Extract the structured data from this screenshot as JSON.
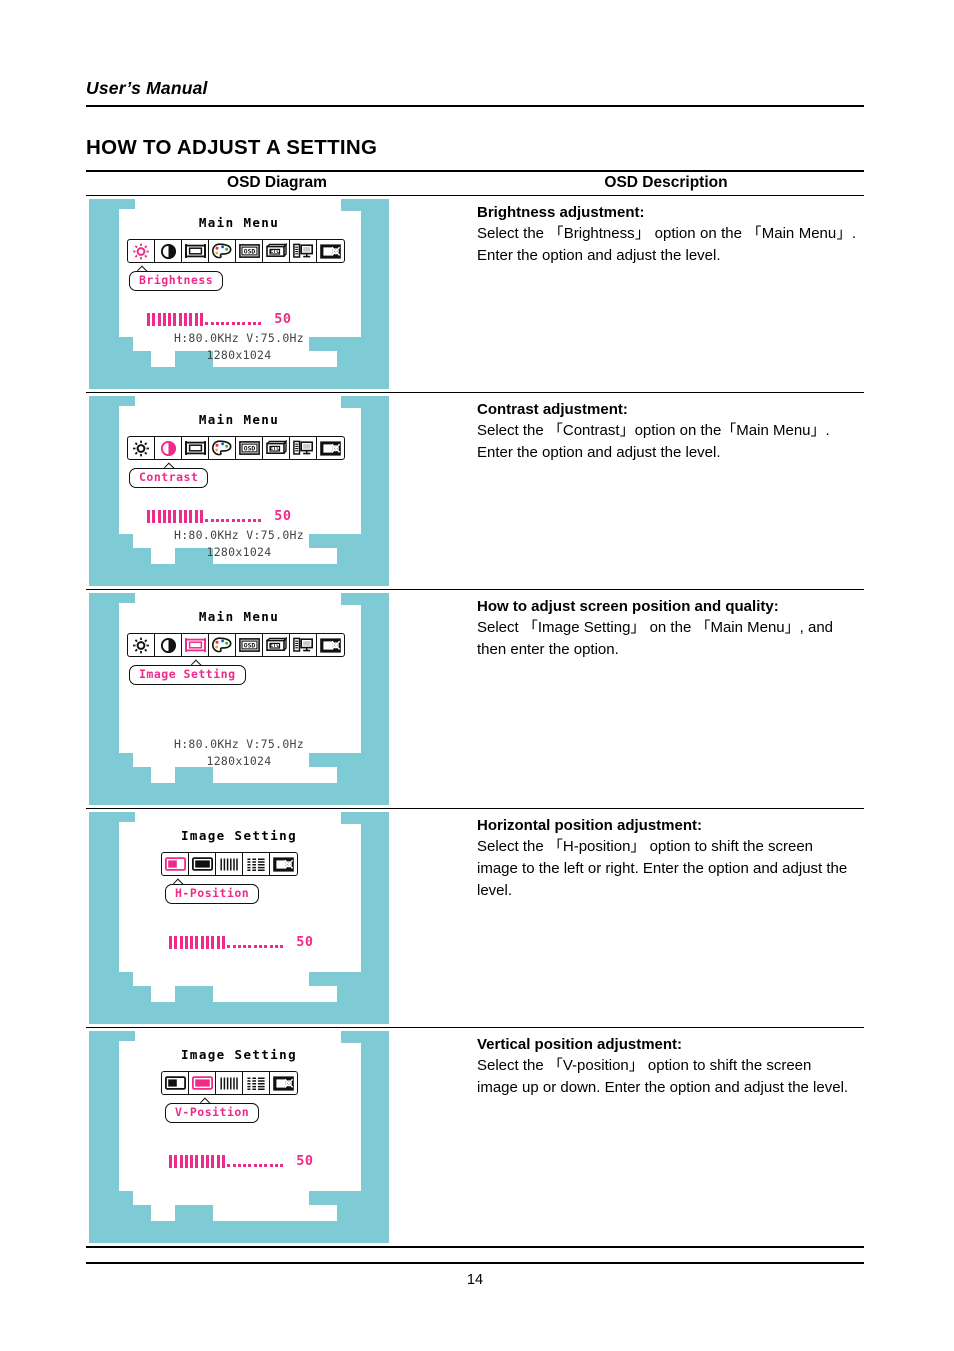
{
  "colors": {
    "teal": "#7ecbd5",
    "pink": "#ee2a8b",
    "rule": "#000000"
  },
  "header": {
    "manual_title": "User’s Manual",
    "section_title": "HOW TO ADJUST A SETTING"
  },
  "table": {
    "columns": {
      "diagram": "OSD Diagram",
      "description": "OSD Description"
    },
    "rows": [
      {
        "diagram": {
          "menu_title": "Main Menu",
          "icons": [
            "brightness-icon",
            "contrast-icon",
            "image-setting-icon",
            "color-icon",
            "osd-icon",
            "etc-icon",
            "information-icon",
            "exit-icon"
          ],
          "selected_index": 0,
          "label": "Brightness",
          "bar": {
            "filled": 11,
            "dots": 11,
            "value": "50"
          },
          "freq_line1": "H:80.0KHz V:75.0Hz",
          "freq_line2": "1280x1024"
        },
        "description": {
          "heading": "Brightness adjustment:",
          "body": "Select the 「Brightness」 option on the 「Main Menu」. Enter the option and adjust the level."
        }
      },
      {
        "diagram": {
          "menu_title": "Main Menu",
          "icons": [
            "brightness-icon",
            "contrast-icon",
            "image-setting-icon",
            "color-icon",
            "osd-icon",
            "etc-icon",
            "information-icon",
            "exit-icon"
          ],
          "selected_index": 1,
          "label": "Contrast",
          "bar": {
            "filled": 11,
            "dots": 11,
            "value": "50"
          },
          "freq_line1": "H:80.0KHz V:75.0Hz",
          "freq_line2": "1280x1024"
        },
        "description": {
          "heading": "Contrast adjustment:",
          "body": "Select the 「Contrast」option on the「Main Menu」. Enter the option and adjust the level."
        }
      },
      {
        "diagram": {
          "menu_title": "Main Menu",
          "icons": [
            "brightness-icon",
            "contrast-icon",
            "image-setting-icon",
            "color-icon",
            "osd-icon",
            "etc-icon",
            "information-icon",
            "exit-icon"
          ],
          "selected_index": 2,
          "label": "Image Setting",
          "bar": null,
          "freq_line1": "H:80.0KHz V:75.0Hz",
          "freq_line2": "1280x1024"
        },
        "description": {
          "heading": "How to adjust screen position and quality:",
          "body": "Select 「Image Setting」 on the 「Main Menu」, and then enter the option."
        }
      },
      {
        "diagram": {
          "menu_title": "Image Setting",
          "icons": [
            "h-position-icon",
            "v-position-icon",
            "clock-icon",
            "phase-icon",
            "exit-icon"
          ],
          "selected_index": 0,
          "label": "H-Position",
          "bar": {
            "filled": 11,
            "dots": 11,
            "value": "50"
          },
          "freq_line1": "",
          "freq_line2": ""
        },
        "description": {
          "heading": "Horizontal position adjustment:",
          "body": "Select the 「H-position」 option to shift the screen image to the left or right. Enter the option and adjust the level."
        }
      },
      {
        "diagram": {
          "menu_title": "Image Setting",
          "icons": [
            "h-position-icon",
            "v-position-icon",
            "clock-icon",
            "phase-icon",
            "exit-icon"
          ],
          "selected_index": 1,
          "label": "V-Position",
          "bar": {
            "filled": 11,
            "dots": 11,
            "value": "50"
          },
          "freq_line1": "",
          "freq_line2": ""
        },
        "description": {
          "heading": "Vertical position adjustment:",
          "body": "Select the 「V-position」 option to shift the screen image up or down. Enter the option and adjust the level."
        }
      }
    ]
  },
  "footer": {
    "page_number": "14"
  }
}
